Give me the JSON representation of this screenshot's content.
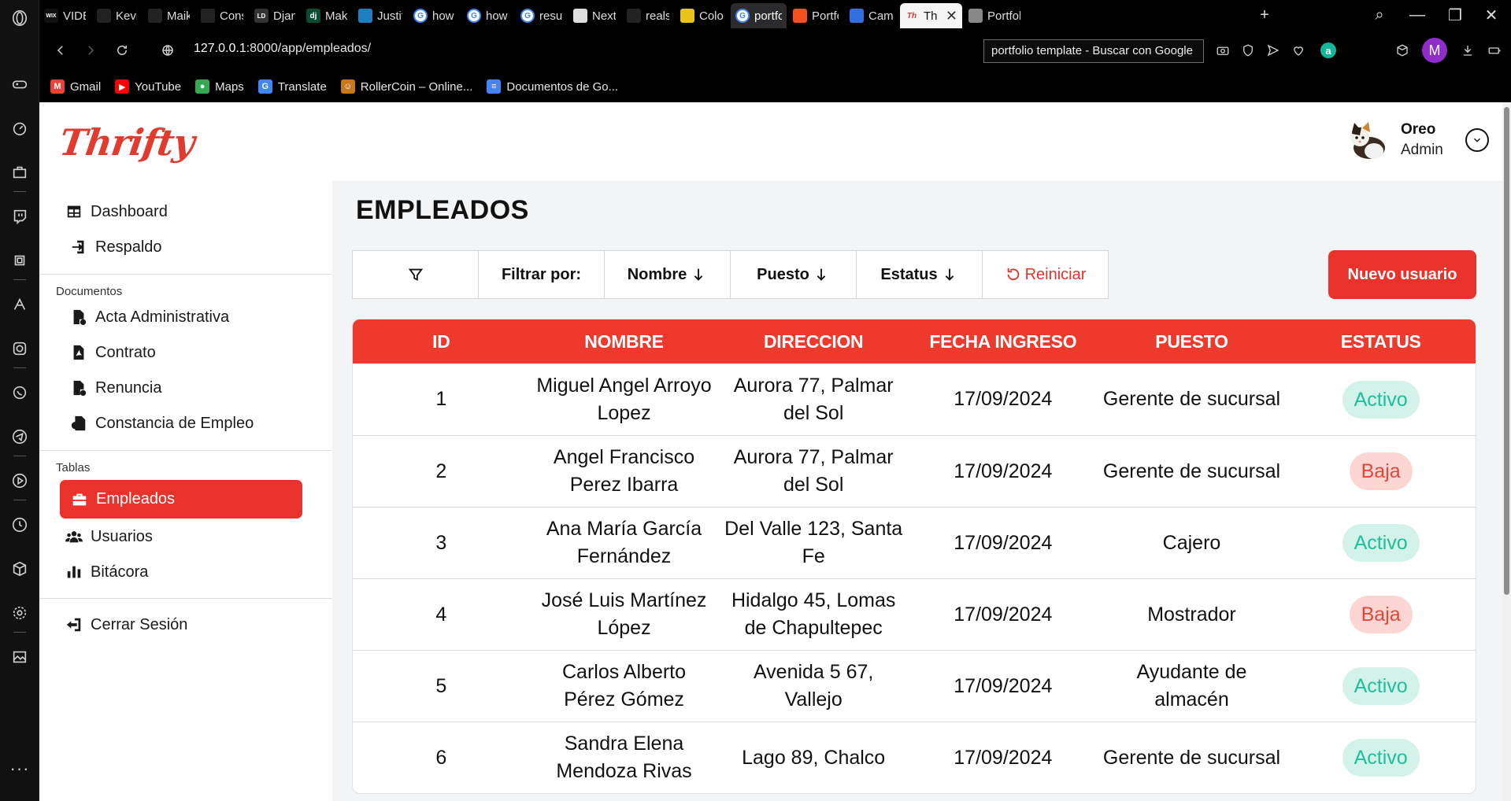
{
  "browser": {
    "tabs": [
      {
        "label": "VIDEO",
        "icon": "wix",
        "color": "#111"
      },
      {
        "label": "Kevin",
        "icon": "spade",
        "color": "#222"
      },
      {
        "label": "Maiky",
        "icon": "github",
        "color": "#222"
      },
      {
        "label": "Consej",
        "icon": "chatgpt",
        "color": "#222"
      },
      {
        "label": "Djang",
        "icon": "ld",
        "color": "#333"
      },
      {
        "label": "Making",
        "icon": "dj",
        "color": "#0c4b33"
      },
      {
        "label": "Justify",
        "icon": "tailwind",
        "color": "#1e7fbf"
      },
      {
        "label": "how to",
        "icon": "google",
        "color": "#fff"
      },
      {
        "label": "how to",
        "icon": "google",
        "color": "#fff"
      },
      {
        "label": "resum",
        "icon": "google",
        "color": "#fff"
      },
      {
        "label": "NextJS",
        "icon": "qr",
        "color": "#ddd"
      },
      {
        "label": "realsto",
        "icon": "github",
        "color": "#222"
      },
      {
        "label": "Color",
        "icon": "palette",
        "color": "#e9c21a"
      },
      {
        "label": "portfol",
        "icon": "google",
        "color": "#fff"
      },
      {
        "label": "Portfol",
        "icon": "figma",
        "color": "#f24e1e"
      },
      {
        "label": "Camer",
        "icon": "flag",
        "color": "#2f6fe0"
      },
      {
        "label": "Thr",
        "icon": "thrifty",
        "color": "#e13a2f"
      },
      {
        "label": "Portfoli",
        "icon": "shirt",
        "color": "#888"
      }
    ],
    "url_host": "127.0.0.1",
    "url_path": ":8000/app/empleados/",
    "search_text": "portfolio template - Buscar con Google",
    "profile_initial": "M",
    "bookmarks": [
      {
        "label": "Gmail",
        "icon": "M",
        "color": "#ea4335"
      },
      {
        "label": "YouTube",
        "icon": "▶",
        "color": "#ff0000"
      },
      {
        "label": "Maps",
        "icon": "●",
        "color": "#34a853"
      },
      {
        "label": "Translate",
        "icon": "G",
        "color": "#4285f4"
      },
      {
        "label": "RollerCoin – Online...",
        "icon": "☺",
        "color": "#c87a1a"
      },
      {
        "label": "Documentos de Go...",
        "icon": "≡",
        "color": "#4285f4"
      }
    ]
  },
  "app": {
    "brand": "Thrifty",
    "user": {
      "name": "Oreo",
      "role": "Admin"
    },
    "sidebar": {
      "top_items": [
        {
          "label": "Dashboard",
          "icon": "table-icon"
        },
        {
          "label": "Respaldo",
          "icon": "import-icon"
        }
      ],
      "groups": [
        {
          "title": "Documentos",
          "items": [
            {
              "label": "Acta Administrativa",
              "icon": "file-alert-icon"
            },
            {
              "label": "Contrato",
              "icon": "file-pdf-icon"
            },
            {
              "label": "Renuncia",
              "icon": "file-x-icon"
            },
            {
              "label": "Constancia de Empleo",
              "icon": "file-badge-icon"
            }
          ]
        },
        {
          "title": "Tablas",
          "items": [
            {
              "label": "Empleados",
              "icon": "briefcase-icon",
              "active": true
            },
            {
              "label": "Usuarios",
              "icon": "users-icon"
            },
            {
              "label": "Bitácora",
              "icon": "bar-chart-icon"
            }
          ]
        }
      ],
      "logout": "Cerrar Sesión"
    },
    "page_title": "EMPLEADOS",
    "filters": {
      "filter_label": "Filtrar por:",
      "by_name": "Nombre",
      "by_role": "Puesto",
      "by_status": "Estatus",
      "reset": "Reiniciar"
    },
    "new_user_button": "Nuevo usuario",
    "table": {
      "headers": [
        "ID",
        "NOMBRE",
        "DIRECCION",
        "FECHA INGRESO",
        "PUESTO",
        "ESTATUS"
      ],
      "rows": [
        {
          "id": "1",
          "name": "Miguel Angel Arroyo Lopez",
          "address": "Aurora 77, Palmar del Sol",
          "date": "17/09/2024",
          "role": "Gerente de sucursal",
          "status": "Activo",
          "status_kind": "on"
        },
        {
          "id": "2",
          "name": "Angel Francisco Perez Ibarra",
          "address": "Aurora 77, Palmar del Sol",
          "date": "17/09/2024",
          "role": "Gerente de sucursal",
          "status": "Baja",
          "status_kind": "off"
        },
        {
          "id": "3",
          "name": "Ana María García Fernández",
          "address": "Del Valle 123, Santa Fe",
          "date": "17/09/2024",
          "role": "Cajero",
          "status": "Activo",
          "status_kind": "on"
        },
        {
          "id": "4",
          "name": "José Luis Martínez López",
          "address": "Hidalgo 45, Lomas de Chapultepec",
          "date": "17/09/2024",
          "role": "Mostrador",
          "status": "Baja",
          "status_kind": "off"
        },
        {
          "id": "5",
          "name": "Carlos Alberto Pérez Gómez",
          "address": "Avenida 5 67, Vallejo",
          "date": "17/09/2024",
          "role": "Ayudante de almacén",
          "status": "Activo",
          "status_kind": "on"
        },
        {
          "id": "6",
          "name": "Sandra Elena Mendoza Rivas",
          "address": "Lago 89, Chalco",
          "date": "17/09/2024",
          "role": "Gerente de sucursal",
          "status": "Activo",
          "status_kind": "on"
        }
      ]
    }
  },
  "colors": {
    "accent": "#e8322b",
    "active_badge": "#1fbf9c",
    "inactive_badge": "#e2473b"
  }
}
